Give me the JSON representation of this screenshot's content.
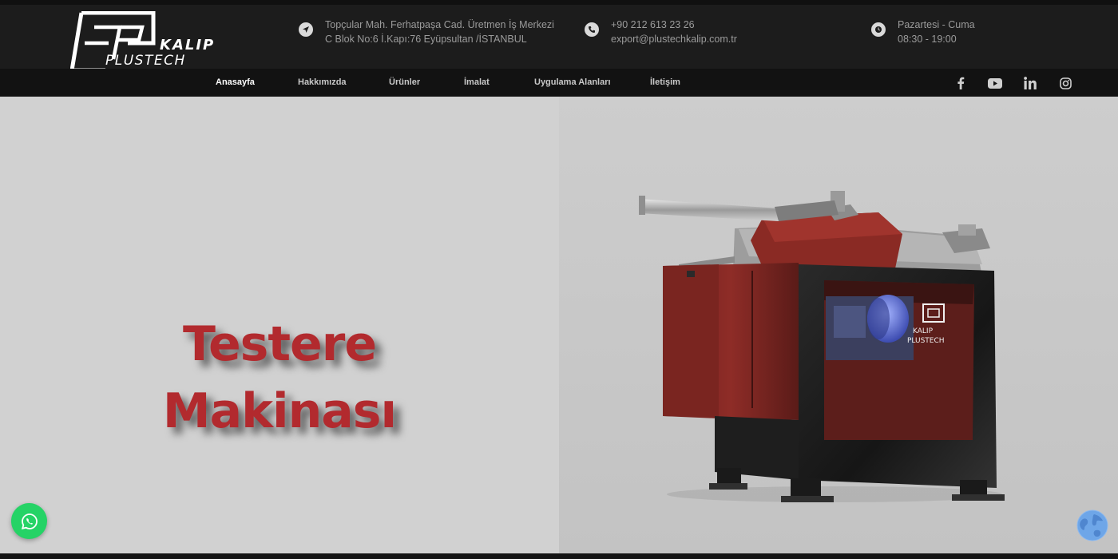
{
  "brand": {
    "logo_kalip": "KALIP",
    "logo_plustech": "PLUSTECH"
  },
  "header": {
    "address": {
      "icon": "location-arrow-icon",
      "line1": "Topçular Mah. Ferhatpaşa Cad. Üretmen İş Merkezi",
      "line2": "C Blok No:6 İ.Kapı:76 Eyüpsultan /İSTANBUL"
    },
    "contact": {
      "icon": "phone-icon",
      "phone": "+90 212 613 23 26",
      "email": "export@plustechkalip.com.tr"
    },
    "hours": {
      "icon": "clock-icon",
      "days": "Pazartesi - Cuma",
      "time": "08:30 - 19:00"
    }
  },
  "nav": {
    "items": [
      {
        "label": "Anasayfa",
        "active": true
      },
      {
        "label": "Hakkımızda",
        "active": false
      },
      {
        "label": "Ürünler",
        "active": false
      },
      {
        "label": "İmalat",
        "active": false
      },
      {
        "label": "Uygulama Alanları",
        "active": false
      },
      {
        "label": "İletişim",
        "active": false
      }
    ],
    "social": [
      "facebook-icon",
      "youtube-icon",
      "linkedin-icon",
      "instagram-icon"
    ]
  },
  "hero": {
    "title_line1": "Testere",
    "title_line2": "Makinası",
    "machine_logo_top": "KALIP",
    "machine_logo_bottom": "PLUSTECH"
  },
  "colors": {
    "header_bg": "#1c1c1c",
    "nav_bg": "#121212",
    "hero_title": "#b22a2e",
    "machine_red": "#8c2a25",
    "whatsapp": "#25d366"
  },
  "floating": {
    "whatsapp_icon": "whatsapp-icon",
    "globe_icon": "globe-icon"
  }
}
